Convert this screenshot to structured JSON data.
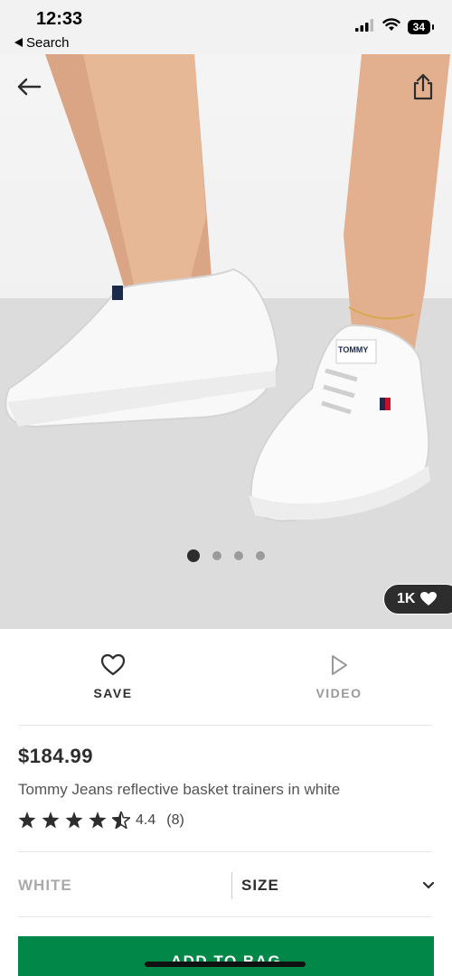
{
  "status": {
    "time": "12:33",
    "back_label": "Search",
    "battery": "34"
  },
  "hero": {
    "likes": "1K",
    "dot_count": 4,
    "active_dot": 0
  },
  "actions": {
    "save_label": "SAVE",
    "video_label": "VIDEO"
  },
  "product": {
    "price": "$184.99",
    "title": "Tommy Jeans reflective basket trainers in white",
    "rating_value": "4.4",
    "rating_count": "(8)",
    "rating_stars": 4.5
  },
  "selectors": {
    "colour": "WHITE",
    "size_label": "SIZE"
  },
  "cta": {
    "add_label": "ADD TO BAG"
  },
  "colors": {
    "accent_green": "#018849",
    "text_dark": "#2d2d2d"
  }
}
